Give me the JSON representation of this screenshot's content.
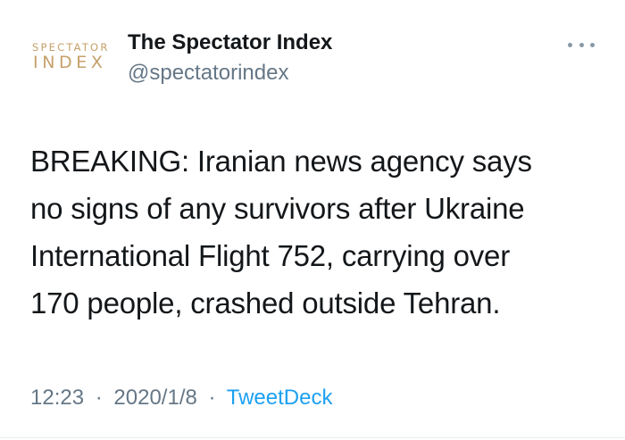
{
  "author": {
    "avatar_logo_top": "SPECTATOR",
    "avatar_logo_bottom": "INDEX",
    "display_name": "The Spectator Index",
    "handle": "@spectatorindex"
  },
  "tweet": {
    "lines": [
      "BREAKING: Iranian news agency says",
      "no signs of any survivors after Ukraine",
      "International Flight 752, carrying over",
      "170 people, crashed outside Tehran."
    ],
    "time": "12:23",
    "date": "2020/1/8",
    "source": "TweetDeck",
    "separator": "·"
  },
  "icons": {
    "more": "more-horizontal-icon"
  },
  "colors": {
    "text": "#14171a",
    "secondary": "#657786",
    "link": "#1da1f2",
    "logo_gold": "#c5a06a"
  }
}
